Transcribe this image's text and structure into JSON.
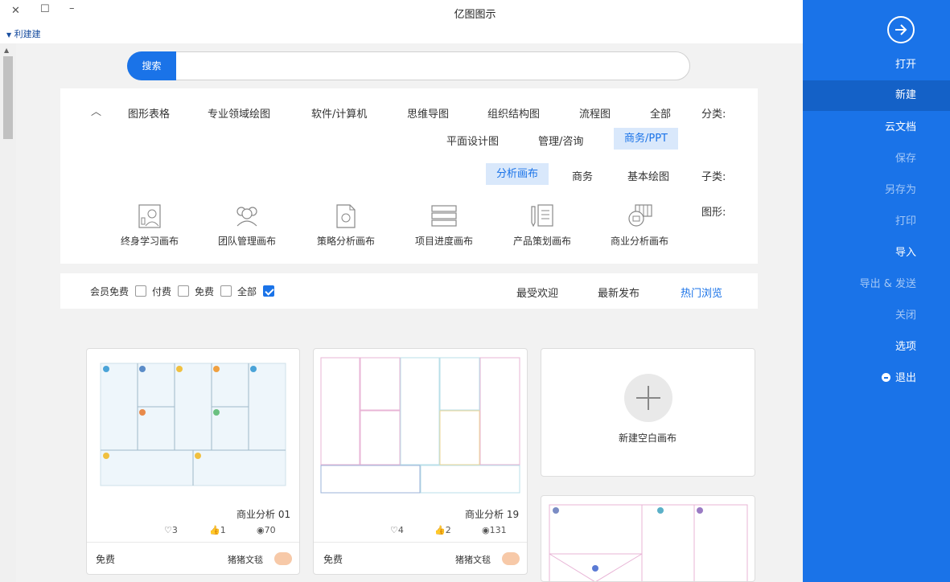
{
  "window": {
    "title": "亿图图示",
    "user": "利建建"
  },
  "sidebar": {
    "items": [
      {
        "label": "打开"
      },
      {
        "label": "新建"
      },
      {
        "label": "云文档"
      },
      {
        "label": "保存"
      },
      {
        "label": "另存为"
      },
      {
        "label": "打印"
      },
      {
        "label": "导入"
      },
      {
        "label": "导出 & 发送"
      },
      {
        "label": "关闭"
      },
      {
        "label": "选项"
      },
      {
        "label": "退出"
      }
    ],
    "active": "新建"
  },
  "search": {
    "button": "搜索",
    "placeholder": ""
  },
  "filters": {
    "category_label": "分类:",
    "categories": [
      "全部",
      "流程图",
      "组织结构图",
      "思维导图",
      "软件/计算机",
      "专业领域绘图",
      "图形表格",
      "商务/PPT",
      "管理/咨询",
      "平面设计图"
    ],
    "selected_category": "商务/PPT",
    "subcategory_label": "子类:",
    "subcategories": [
      "基本绘图",
      "商务",
      "分析画布"
    ],
    "selected_subcategory": "分析画布",
    "shapes_label": "图形:",
    "shapes": [
      {
        "label": "商业分析画布",
        "icon": "business-canvas-icon"
      },
      {
        "label": "产品策划画布",
        "icon": "product-plan-icon"
      },
      {
        "label": "项目进度画布",
        "icon": "project-progress-icon"
      },
      {
        "label": "策略分析画布",
        "icon": "strategy-analysis-icon"
      },
      {
        "label": "团队管理画布",
        "icon": "team-management-icon"
      },
      {
        "label": "终身学习画布",
        "icon": "lifelong-learning-icon"
      }
    ]
  },
  "sort": {
    "tabs": [
      "热门浏览",
      "最新发布",
      "最受欢迎"
    ],
    "selected": "热门浏览",
    "price_filters": [
      {
        "label": "全部",
        "checked": true
      },
      {
        "label": "免费",
        "checked": false
      },
      {
        "label": "付费",
        "checked": false
      },
      {
        "label": "会员免费",
        "checked": false
      }
    ]
  },
  "cards": {
    "new_blank": "新建空白画布",
    "templates": [
      {
        "title": "商业分析 19",
        "views": "131",
        "likes": "2",
        "favs": "4",
        "author": "猪猪文毯",
        "price": "免费"
      },
      {
        "title": "商业分析 01",
        "views": "70",
        "likes": "1",
        "favs": "3",
        "author": "猪猪文毯",
        "price": "免费"
      }
    ]
  },
  "colors": {
    "accent": "#1a73e8",
    "sidebar_bg": "#1a73e8",
    "selected_chip_bg": "#d9e8fb"
  }
}
